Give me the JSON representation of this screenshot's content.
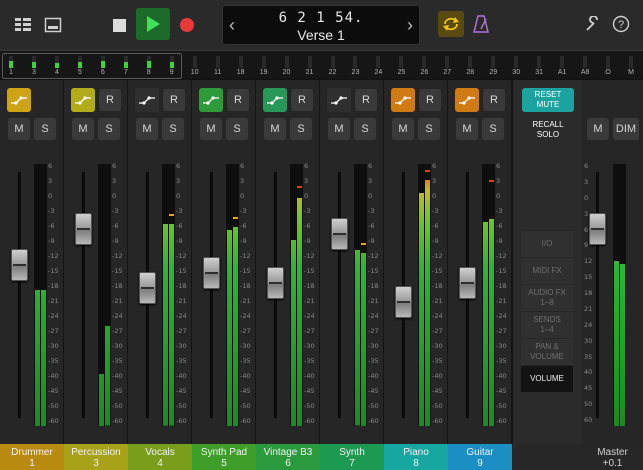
{
  "transport": {
    "position": "6  2  1    54.",
    "section": "Verse 1",
    "prev_icon": "chevron-left-icon",
    "next_icon": "chevron-right-icon"
  },
  "meter_strip": {
    "labels": [
      "1",
      "3",
      "4",
      "5",
      "6",
      "7",
      "8",
      "9",
      "10",
      "11",
      "18",
      "19",
      "20",
      "21",
      "22",
      "23",
      "24",
      "25",
      "26",
      "27",
      "28",
      "29",
      "30",
      "31",
      "A1",
      "A8",
      "O",
      "M"
    ],
    "levels": [
      0.6,
      0.5,
      0.4,
      0.5,
      0.6,
      0.5,
      0.6,
      0.5,
      0,
      0,
      0,
      0,
      0,
      0,
      0,
      0,
      0,
      0,
      0,
      0,
      0,
      0,
      0,
      0,
      0,
      0,
      0,
      0
    ]
  },
  "db_scale": [
    "6",
    "3",
    "0",
    "-3",
    "-6",
    "-9",
    "-12",
    "-15",
    "-18",
    "-21",
    "-24",
    "-27",
    "-30",
    "-35",
    "-40",
    "-45",
    "-50",
    "-60"
  ],
  "master_scale": [
    "6",
    "3",
    "0",
    "3",
    "6",
    "9",
    "12",
    "15",
    "18",
    "21",
    "24",
    "30",
    "35",
    "40",
    "45",
    "50",
    "60"
  ],
  "strip_buttons": {
    "mute": "M",
    "solo": "S",
    "record": "R"
  },
  "channels": [
    {
      "name": "Drummer",
      "number": "1",
      "color": "#b88a10",
      "auto_color": "#cfa414",
      "has_record": false,
      "fader": 0.62,
      "meter_l": 0.52,
      "meter_r": 0.52,
      "peak": 0
    },
    {
      "name": "Percussion",
      "number": "3",
      "color": "#a7a217",
      "auto_color": "#b3ac1a",
      "has_record": true,
      "fader": 0.77,
      "meter_l": 0.2,
      "meter_r": 0.38,
      "peak": 0
    },
    {
      "name": "Vocals",
      "number": "4",
      "color": "#7a9e1c",
      "auto_color": "#2f2f2f",
      "has_record": true,
      "fader": 0.53,
      "meter_l": 0.77,
      "meter_r": 0.77,
      "peak": 0.8
    },
    {
      "name": "Synth Pad",
      "number": "5",
      "color": "#3f9d2a",
      "auto_color": "#2f9a3a",
      "has_record": true,
      "fader": 0.59,
      "meter_l": 0.75,
      "meter_r": 0.76,
      "peak": 0.79
    },
    {
      "name": "Vintage B3",
      "number": "6",
      "color": "#2b9a3d",
      "auto_color": "#27985a",
      "has_record": true,
      "fader": 0.55,
      "meter_l": 0.71,
      "meter_r": 0.87,
      "peak": 0.91
    },
    {
      "name": "Synth",
      "number": "7",
      "color": "#1d9a52",
      "auto_color": "#2f2f2f",
      "has_record": true,
      "fader": 0.75,
      "meter_l": 0.67,
      "meter_r": 0.66,
      "peak": 0.69
    },
    {
      "name": "Piano",
      "number": "8",
      "color": "#18a6a0",
      "auto_color": "#cf7a12",
      "has_record": true,
      "fader": 0.47,
      "meter_l": 0.89,
      "meter_r": 0.94,
      "peak": 0.97
    },
    {
      "name": "Guitar",
      "number": "9",
      "color": "#1b8ec4",
      "auto_color": "#cf7a12",
      "has_record": true,
      "fader": 0.55,
      "meter_l": 0.78,
      "meter_r": 0.79,
      "peak": 0.93
    }
  ],
  "control_panel": {
    "reset_line1": "RESET",
    "reset_line2": "MUTE",
    "recall_line1": "RECALL",
    "recall_line2": "SOLO",
    "views": [
      "I/O",
      "MIDI FX",
      "AUDIO FX",
      "SENDS",
      "PAN &",
      "VOLUME"
    ],
    "views_sub": [
      "",
      "",
      "1–8",
      "1–4",
      "VOLUME",
      ""
    ]
  },
  "master": {
    "name": "Master",
    "value": "+0.1",
    "mute": "M",
    "dim": "DIM",
    "fader": 0.77,
    "meter_l": 0.63,
    "meter_r": 0.62
  }
}
